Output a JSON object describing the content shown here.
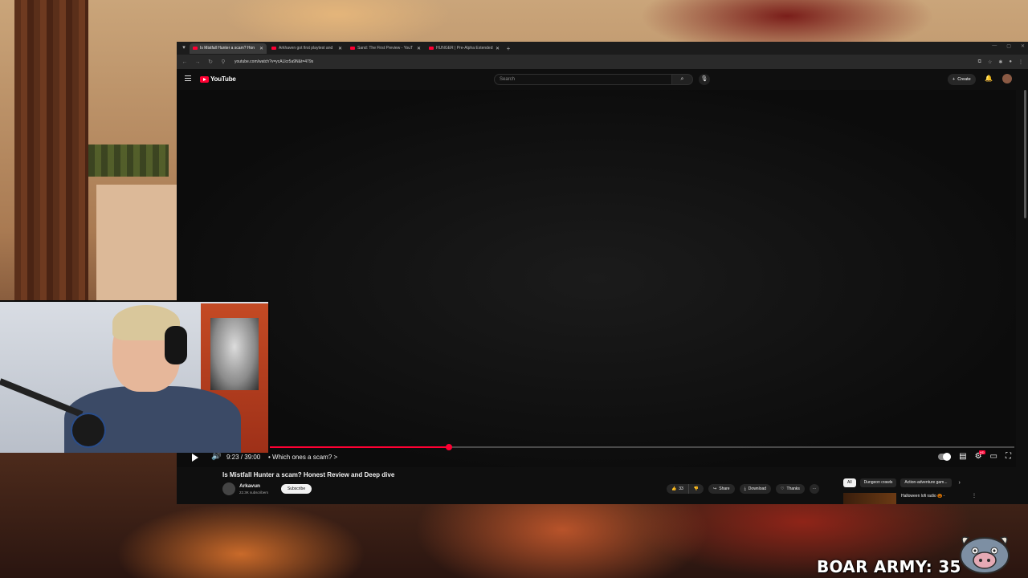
{
  "browser": {
    "tabs": [
      {
        "title": "Is Mistfall Hunter a scam? Hon",
        "active": true
      },
      {
        "title": "Arkhaven got first playtest and",
        "active": false
      },
      {
        "title": "Sand: The First Preview - YouT",
        "active": false
      },
      {
        "title": "HUNGER | Pre-Alpha Extended",
        "active": false
      }
    ],
    "url": "youtube.com/watch?v=ycALlcr5a9N&t=479s"
  },
  "youtube": {
    "logo_text": "YouTube",
    "search_placeholder": "Search",
    "create_label": "Create"
  },
  "player": {
    "progress_fraction": 0.241,
    "time": "9:23 / 39:00",
    "chapter": "• Which ones a scam? >"
  },
  "video": {
    "title": "Is Mistfall Hunter a scam? Honest Review and Deep dive",
    "channel": "Arkavun",
    "subscribers": "22.3K subscribers",
    "subscribe_label": "Subscribe",
    "like_count": "33",
    "share_label": "Share",
    "download_label": "Download",
    "thanks_label": "Thanks"
  },
  "recommendations": {
    "chips": [
      "All",
      "Dungeon crawls",
      "Action-adventure gam..."
    ],
    "first_title": "Halloween lofi radio 🎃 -"
  },
  "overlay": {
    "counter_text": "BOAR ARMY: 35"
  },
  "colors": {
    "youtube_red": "#ff0033",
    "player_bg": "#0f0f0f"
  }
}
